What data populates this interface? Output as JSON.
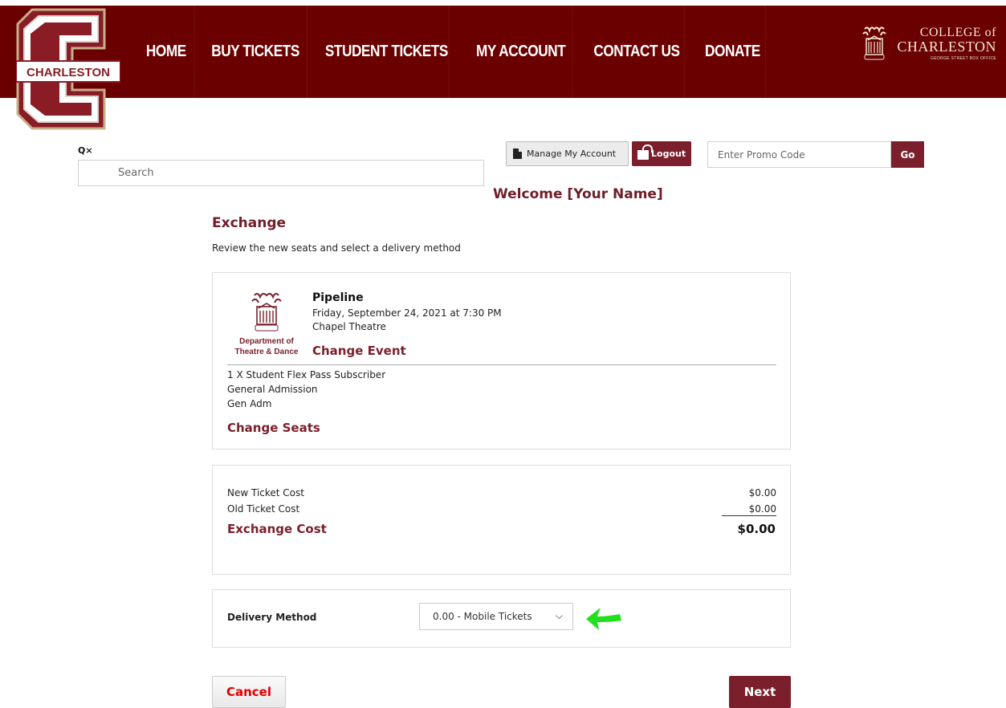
{
  "header": {
    "logo_text": "CHARLESTON",
    "nav": [
      {
        "label": "HOME"
      },
      {
        "label": "BUY TICKETS"
      },
      {
        "label": "STUDENT TICKETS"
      },
      {
        "label": "MY ACCOUNT"
      },
      {
        "label": "CONTACT US"
      },
      {
        "label": "DONATE"
      }
    ],
    "college_logo": {
      "line1": "COLLEGE of",
      "line2": "CHARLESTON",
      "line3": "GEORGE STREET BOX OFFICE"
    }
  },
  "search": {
    "placeholder": "Search",
    "icons": "Q×"
  },
  "account": {
    "manage_label": "Manage My Account",
    "logout_label": "Logout"
  },
  "promo": {
    "placeholder": "Enter Promo Code",
    "go_label": "Go"
  },
  "welcome": "Welcome [Your Name]",
  "page": {
    "title": "Exchange",
    "subtitle": "Review the new seats and select a delivery method"
  },
  "event": {
    "dept_label_1": "Department of",
    "dept_label_2": "Theatre & Dance",
    "name": "Pipeline",
    "date": "Friday, September 24, 2021 at 7:30 PM",
    "venue": "Chapel Theatre",
    "change_event": "Change Event",
    "seat_lines": [
      "1 X Student Flex Pass Subscriber",
      "General Admission",
      "Gen Adm"
    ],
    "change_seats": "Change Seats"
  },
  "costs": {
    "new_label": "New Ticket Cost",
    "new_value": "$0.00",
    "old_label": "Old Ticket Cost",
    "old_value": "$0.00",
    "exchange_label": "Exchange Cost",
    "exchange_value": "$0.00"
  },
  "delivery": {
    "label": "Delivery Method",
    "selected": "0.00 - Mobile Tickets"
  },
  "actions": {
    "cancel": "Cancel",
    "next": "Next"
  },
  "colors": {
    "header_bg": "#6b0000",
    "accent": "#7a1f2b",
    "cancel_text": "#e00000",
    "arrow": "#22e01f"
  }
}
